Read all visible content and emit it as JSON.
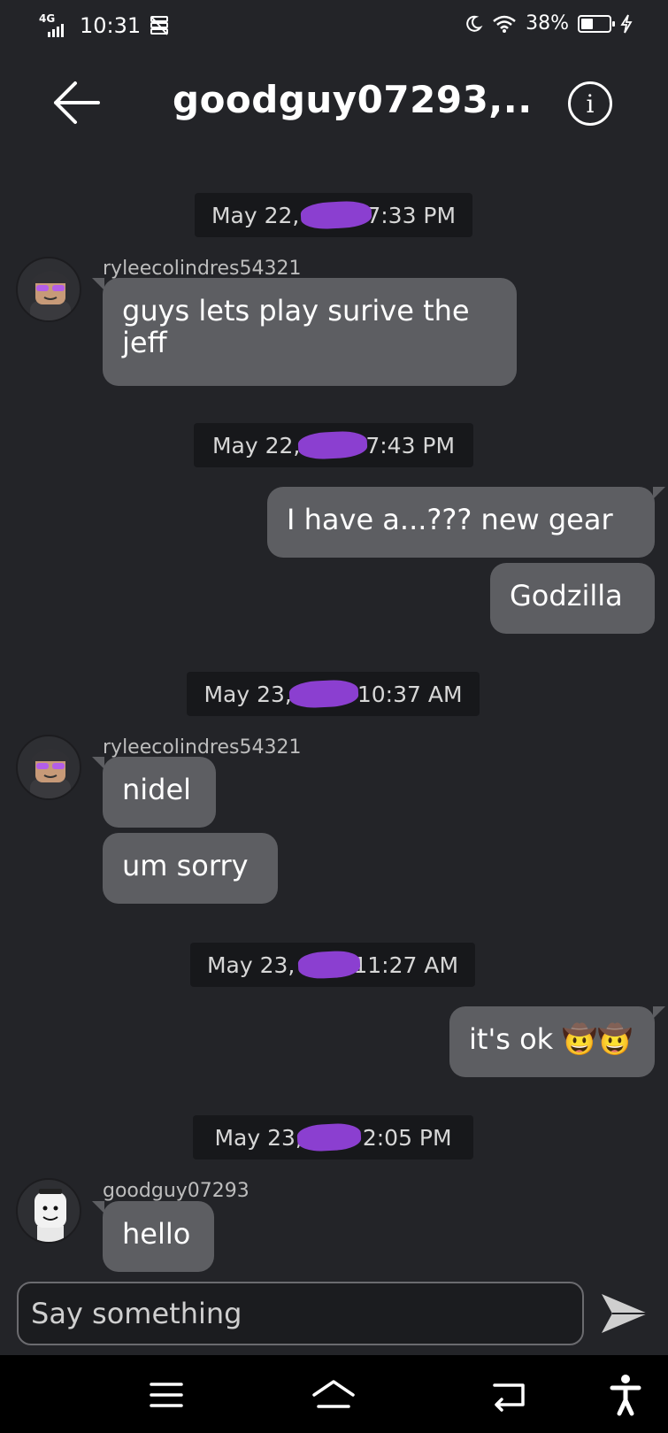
{
  "status_bar": {
    "network": "4G",
    "time": "10:31",
    "battery": "38%",
    "battery_level": 0.38
  },
  "header": {
    "title": "goodguy07293,...",
    "info_icon": "i"
  },
  "messages": [
    {
      "kind": "date",
      "text": "May 22, ",
      "time": "7:33 PM"
    },
    {
      "kind": "incoming",
      "sender": "ryleecolindres54321",
      "bubbles": [
        "guys lets play surive the jeff"
      ]
    },
    {
      "kind": "date",
      "text": "May 22, ",
      "time": "7:43 PM"
    },
    {
      "kind": "outgoing",
      "bubbles": [
        "I have a...??? new gear",
        "Godzilla"
      ]
    },
    {
      "kind": "date",
      "text": "May 23, ",
      "time": "10:37 AM"
    },
    {
      "kind": "incoming",
      "sender": "ryleecolindres54321",
      "bubbles": [
        "nidel",
        "um sorry"
      ]
    },
    {
      "kind": "date",
      "text": "May 23, ",
      "time": "11:27 AM"
    },
    {
      "kind": "outgoing",
      "bubbles": [
        "it's ok 🤠🤠"
      ]
    },
    {
      "kind": "date",
      "text": "May 23, ",
      "time": "2:05 PM"
    },
    {
      "kind": "incoming",
      "sender": "goodguy07293",
      "bubbles": [
        "hello"
      ]
    }
  ],
  "composer": {
    "placeholder": "Say something"
  },
  "colors": {
    "background": "#232428",
    "bubble": "#5d5e62",
    "date_pill": "#17181b",
    "redaction": "#8b3fd0"
  },
  "icons": {
    "back": "arrow-left-icon",
    "info": "info-icon",
    "send": "send-icon",
    "nav": [
      "menu-icon",
      "home-icon",
      "back-icon",
      "accessibility-icon"
    ]
  }
}
